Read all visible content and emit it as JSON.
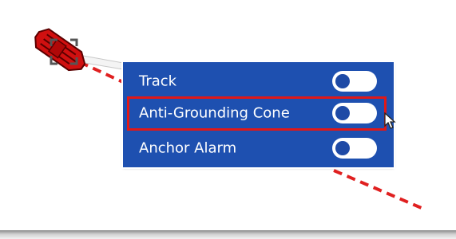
{
  "menu": {
    "items": [
      {
        "label": "Track",
        "toggle_on": false
      },
      {
        "label": "Anti-Grounding Cone",
        "toggle_on": false,
        "highlighted": true
      },
      {
        "label": "Anchor Alarm",
        "toggle_on": false
      }
    ]
  },
  "colors": {
    "menu_background": "#1e50b0",
    "toggle_track": "#ffffff",
    "toggle_knob": "#1e4aa6",
    "highlight_border": "#e01818",
    "vessel_fill": "#d01010",
    "track_line": "#e02020"
  },
  "icons": {
    "vessel": "vessel-icon",
    "selection_brackets": "selection-bracket-icon",
    "cursor": "mouse-pointer-icon"
  }
}
